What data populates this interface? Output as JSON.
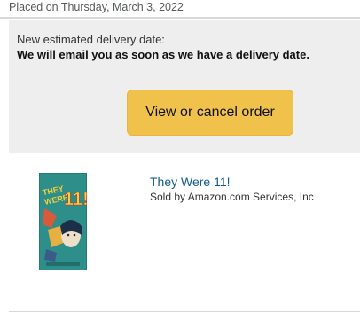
{
  "order": {
    "placed_label": "Placed on Thursday, March 3, 2022"
  },
  "delivery": {
    "label": "New estimated delivery date:",
    "message": "We will email you as soon as we have a delivery date.",
    "button_label": "View or cancel order"
  },
  "product": {
    "title": "They Were 11!",
    "seller": "Sold by Amazon.com Services, Inc",
    "cover_title_art": "THEY WERE 11!",
    "image_icon": "book-cover-image"
  },
  "colors": {
    "button": "#f0c14b",
    "link": "#0f5a91",
    "panel": "#eeeeee",
    "cover_bg": "#2e8e8a"
  }
}
